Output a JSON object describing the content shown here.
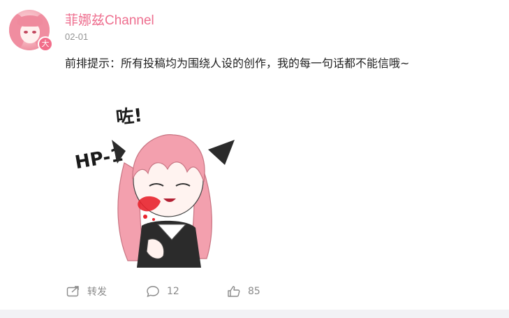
{
  "post": {
    "username": "菲娜兹Channel",
    "date": "02-01",
    "badge": "大",
    "text": "前排提示：所有投稿均为围绕人设的创作，我的每一句话都不能信哦~"
  },
  "sticker": {
    "caption_hp": "HP-1",
    "caption_exclaim": "咗!"
  },
  "actions": {
    "repost_label": "转发",
    "comment_count": "12",
    "like_count": "85"
  },
  "colors": {
    "username": "#ee6f8f",
    "meta": "#939393",
    "icon": "#8a8a8a",
    "hair": "#f3a0ae",
    "blood": "#e8232d"
  }
}
